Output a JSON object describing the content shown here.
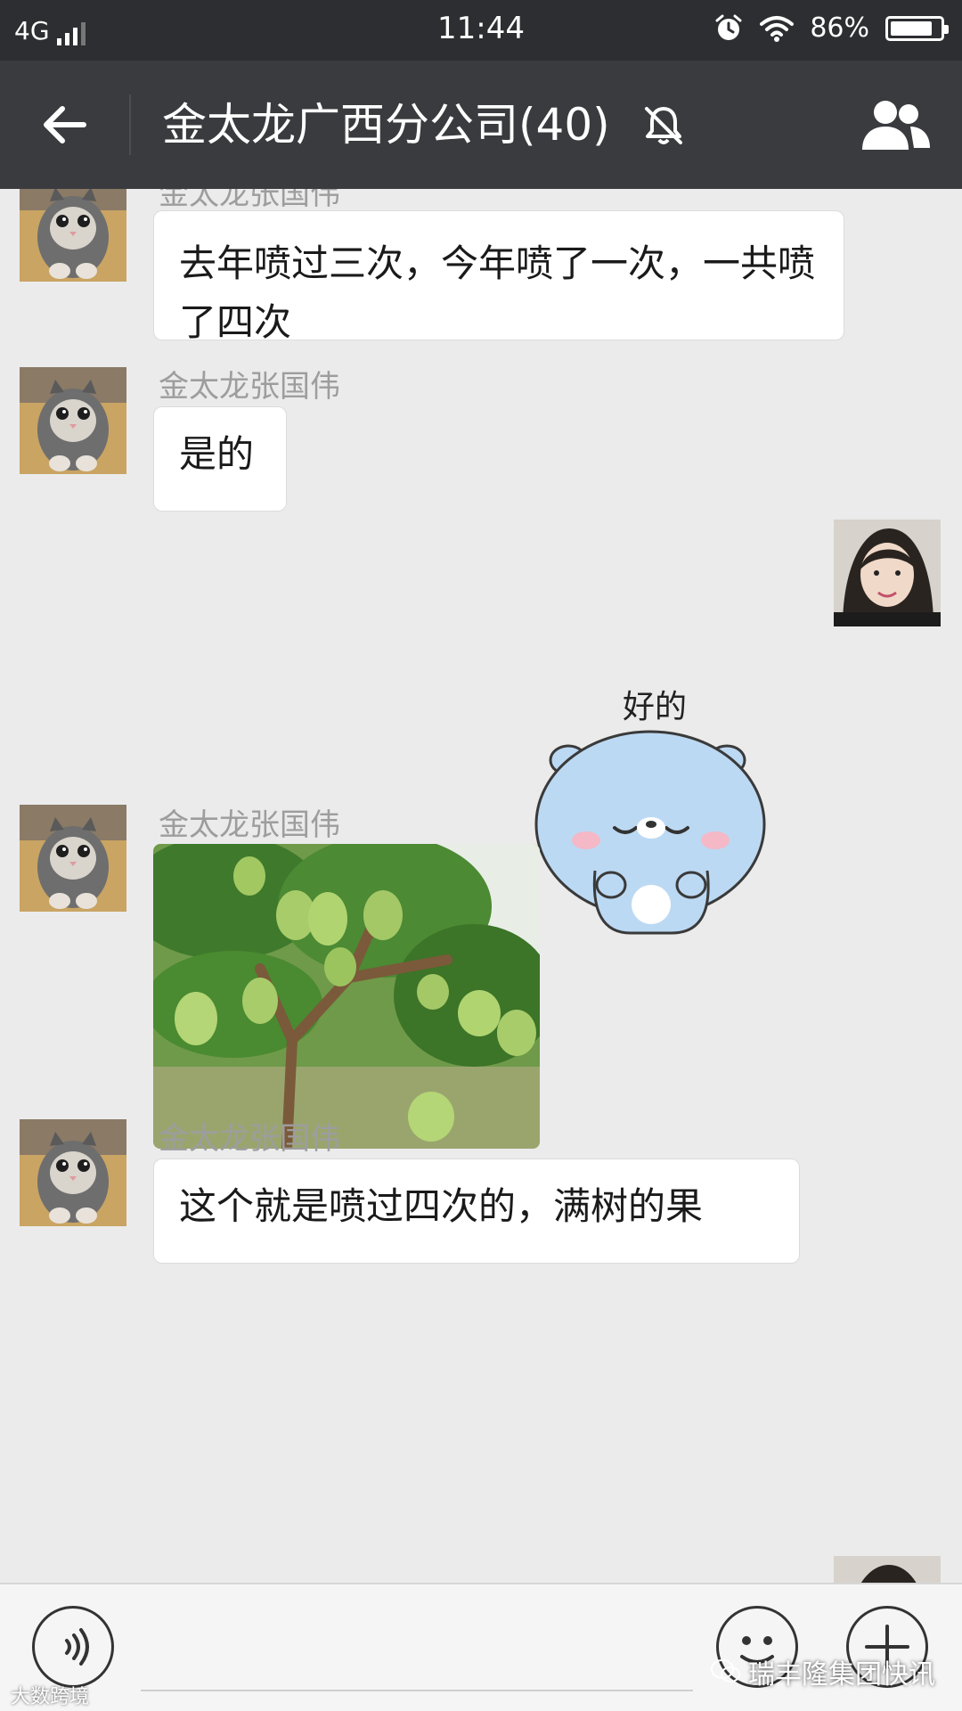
{
  "status_bar": {
    "network": "4G",
    "time": "11:44",
    "battery": "86%",
    "battery_level": 0.86,
    "icons": [
      "signal-icon",
      "alarm-icon",
      "wifi-icon",
      "battery-icon"
    ]
  },
  "header": {
    "title": "金太龙广西分公司(40)",
    "icons": [
      "back-arrow-icon",
      "mute-bell-icon",
      "group-members-icon"
    ]
  },
  "messages": [
    {
      "sender": "金太龙张国伟",
      "side": "left",
      "type": "text",
      "text": "去年喷过三次，今年喷了一次，一共喷了四次"
    },
    {
      "sender": "金太龙张国伟",
      "side": "left",
      "type": "text",
      "text": "是的"
    },
    {
      "sender": "",
      "side": "right",
      "type": "sticker",
      "sticker_text": "好的"
    },
    {
      "sender": "金太龙张国伟",
      "side": "left",
      "type": "image",
      "image": "guava-tree-photo"
    },
    {
      "sender": "金太龙张国伟",
      "side": "left",
      "type": "text",
      "text": "这个就是喷过四次的，满树的果"
    }
  ],
  "input_bar": {
    "icons": [
      "voice-icon",
      "emoji-icon",
      "plus-icon"
    ]
  },
  "watermarks": {
    "right": "瑞丰隆集团快讯",
    "left": "大数跨境"
  },
  "colors": {
    "status_bar": "#2d2e31",
    "nav_bar": "#3a3b3f",
    "chat_background": "#ebebeb",
    "bubble": "#ffffff",
    "sender_name": "#9d9d9d"
  }
}
